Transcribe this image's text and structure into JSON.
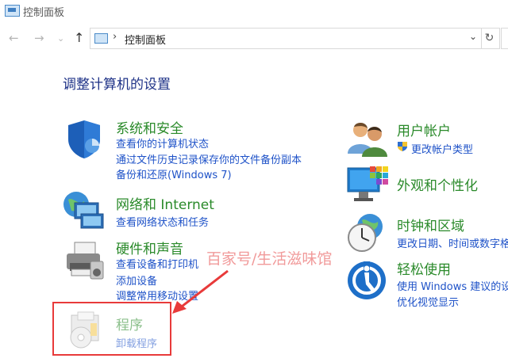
{
  "window": {
    "title": "控制面板"
  },
  "nav": {
    "back": "←",
    "forward": "→",
    "dropdown": "⌄",
    "up": "↑",
    "address_sep": "›",
    "address_crumb": "控制面板",
    "address_dropdown": "⌄",
    "refresh": "↻"
  },
  "heading": "调整计算机的设置",
  "categories": {
    "system_security": {
      "title": "系统和安全",
      "links": [
        "查看你的计算机状态",
        "通过文件历史记录保存你的文件备份副本",
        "备份和还原(Windows 7)"
      ]
    },
    "network": {
      "title": "网络和 Internet",
      "links": [
        "查看网络状态和任务"
      ]
    },
    "hardware_sound": {
      "title": "硬件和声音",
      "links": [
        "查看设备和打印机",
        "添加设备",
        "调整常用移动设置"
      ]
    },
    "programs": {
      "title": "程序",
      "links": [
        "卸载程序"
      ]
    },
    "user_accounts": {
      "title": "用户帐户",
      "links": [
        "更改帐户类型"
      ]
    },
    "appearance": {
      "title": "外观和个性化",
      "links": []
    },
    "clock_region": {
      "title": "时钟和区域",
      "links": [
        "更改日期、时间或数字格式"
      ]
    },
    "ease_of_access": {
      "title": "轻松使用",
      "links": [
        "使用 Windows 建议的设置",
        "优化视觉显示"
      ]
    }
  },
  "watermark": "百家号/生活滋味馆",
  "colors": {
    "heading": "#1e3287",
    "category_title": "#2a8a2a",
    "link": "#1e52c8",
    "annotation": "#e83a3a"
  }
}
